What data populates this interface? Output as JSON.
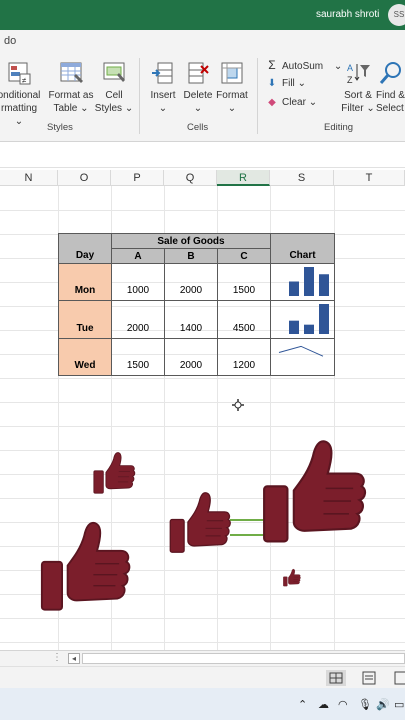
{
  "titlebar": {
    "user_name": "saurabh shroti",
    "avatar_initials": "SS"
  },
  "ribbon": {
    "tell_me_fragment": "do",
    "styles": {
      "conditional_formatting": [
        "onditional",
        "rmatting"
      ],
      "format_as_table": [
        "Format as",
        "Table"
      ],
      "cell_styles": [
        "Cell",
        "Styles"
      ],
      "group_label": "Styles"
    },
    "cells": {
      "insert": "Insert",
      "delete": "Delete",
      "format": "Format",
      "group_label": "Cells"
    },
    "editing": {
      "autosum": "AutoSum",
      "fill": "Fill",
      "clear": "Clear",
      "sort_filter": [
        "Sort &",
        "Filter"
      ],
      "find_select": [
        "Find &",
        "Select"
      ],
      "group_label": "Editing"
    }
  },
  "grid": {
    "columns": [
      {
        "label": "N",
        "selected": false
      },
      {
        "label": "O",
        "selected": false
      },
      {
        "label": "P",
        "selected": false
      },
      {
        "label": "Q",
        "selected": false
      },
      {
        "label": "R",
        "selected": true
      },
      {
        "label": "S",
        "selected": false
      },
      {
        "label": "T",
        "selected": false
      }
    ]
  },
  "table": {
    "header_day": "Day",
    "header_group": "Sale of Goods",
    "header_chart": "Chart",
    "sub_headers": [
      "A",
      "B",
      "C"
    ],
    "rows": [
      {
        "day": "Mon",
        "values": [
          "1000",
          "2000",
          "1500"
        ],
        "spark": "column",
        "data": [
          1000,
          2000,
          1500
        ]
      },
      {
        "day": "Tue",
        "values": [
          "2000",
          "1400",
          "4500"
        ],
        "spark": "column",
        "data": [
          2000,
          1400,
          4500
        ]
      },
      {
        "day": "Wed",
        "values": [
          "1500",
          "2000",
          "1200"
        ],
        "spark": "line",
        "data": [
          1500,
          2000,
          1200
        ]
      }
    ]
  },
  "colors": {
    "excel_green": "#217346",
    "header_gray": "#bfbfbf",
    "day_peach": "#f8cbad",
    "spark_blue": "#2f5597",
    "thumb_maroon": "#7b1e2b"
  }
}
